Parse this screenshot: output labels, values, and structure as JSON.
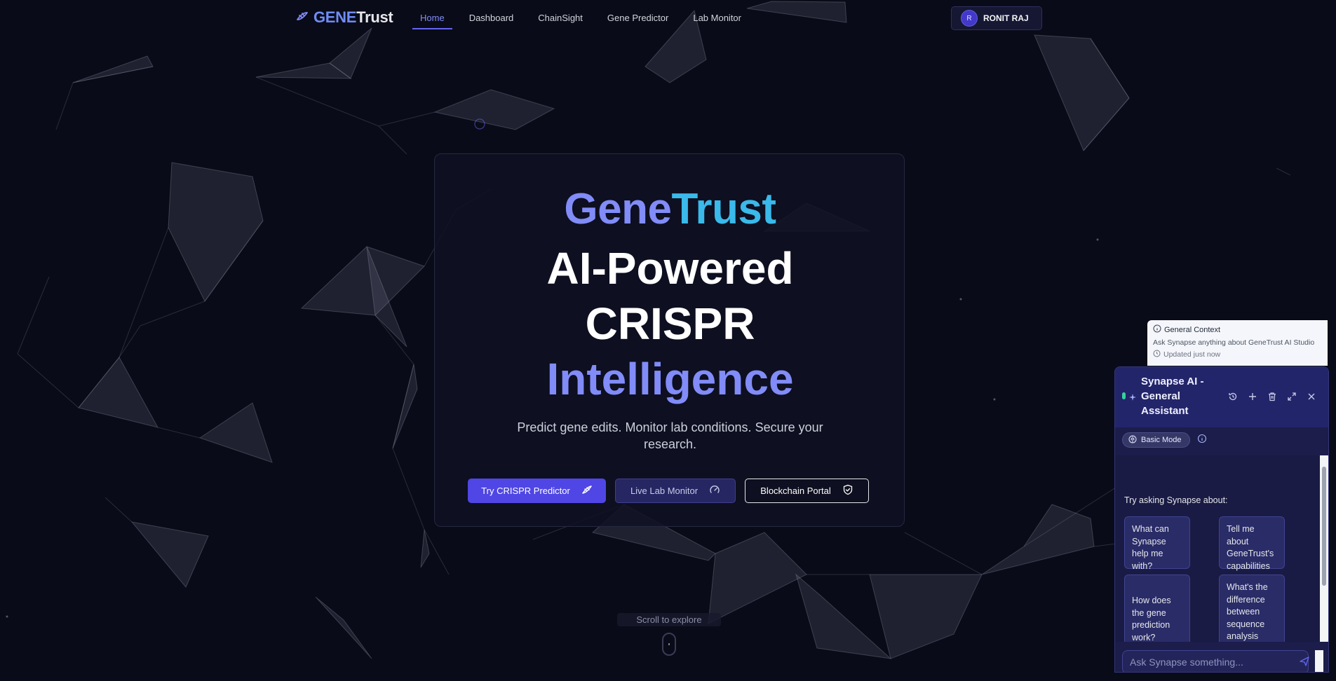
{
  "nav": {
    "logo_part1": "GENE",
    "logo_part2": "Trust",
    "links": [
      "Home",
      "Dashboard",
      "ChainSight",
      "Gene Predictor",
      "Lab Monitor"
    ],
    "active_link": "Home",
    "user": {
      "initial": "R",
      "name": "RONIT RAJ"
    }
  },
  "hero": {
    "brand_part1": "Gene",
    "brand_part2": "Trust",
    "headline_line1": "AI-Powered",
    "headline_line2": "CRISPR",
    "headline_line3": "Intelligence",
    "subtitle": "Predict gene edits. Monitor lab conditions. Secure your research.",
    "buttons": {
      "primary": "Try CRISPR Predictor",
      "secondary": "Live Lab Monitor",
      "outline": "Blockchain Portal"
    },
    "scroll_hint": "Scroll to explore"
  },
  "context": {
    "title": "General Context",
    "description": "Ask Synapse anything about GeneTrust AI Studio",
    "updated": "Updated just now"
  },
  "chat": {
    "title": "Synapse AI - General Assistant",
    "mode": "Basic Mode",
    "try_label": "Try asking Synapse about:",
    "suggestions": [
      "What can Synapse help me with?",
      "Tell me about GeneTrust's capabilities",
      "How does the gene prediction work?",
      "What's the difference between sequence analysis types?"
    ],
    "input_placeholder": "Ask Synapse something..."
  },
  "colors": {
    "background": "#0a0b18",
    "accent": "#4f46e5",
    "accent_light": "#818cf8",
    "cyan": "#3ab9ea",
    "status_online": "#34d399"
  },
  "icons": {
    "logo": "dna-icon",
    "primary_button": "dna-icon",
    "secondary_button": "gauge-icon",
    "outline_button": "shield-check-icon",
    "context": "info-icon",
    "updated": "clock-icon",
    "chat_header": [
      "history-icon",
      "plus-icon",
      "trash-icon",
      "expand-icon",
      "close-icon"
    ],
    "mode": "brain-icon",
    "mode_info": "info-icon",
    "send": "send-icon"
  }
}
